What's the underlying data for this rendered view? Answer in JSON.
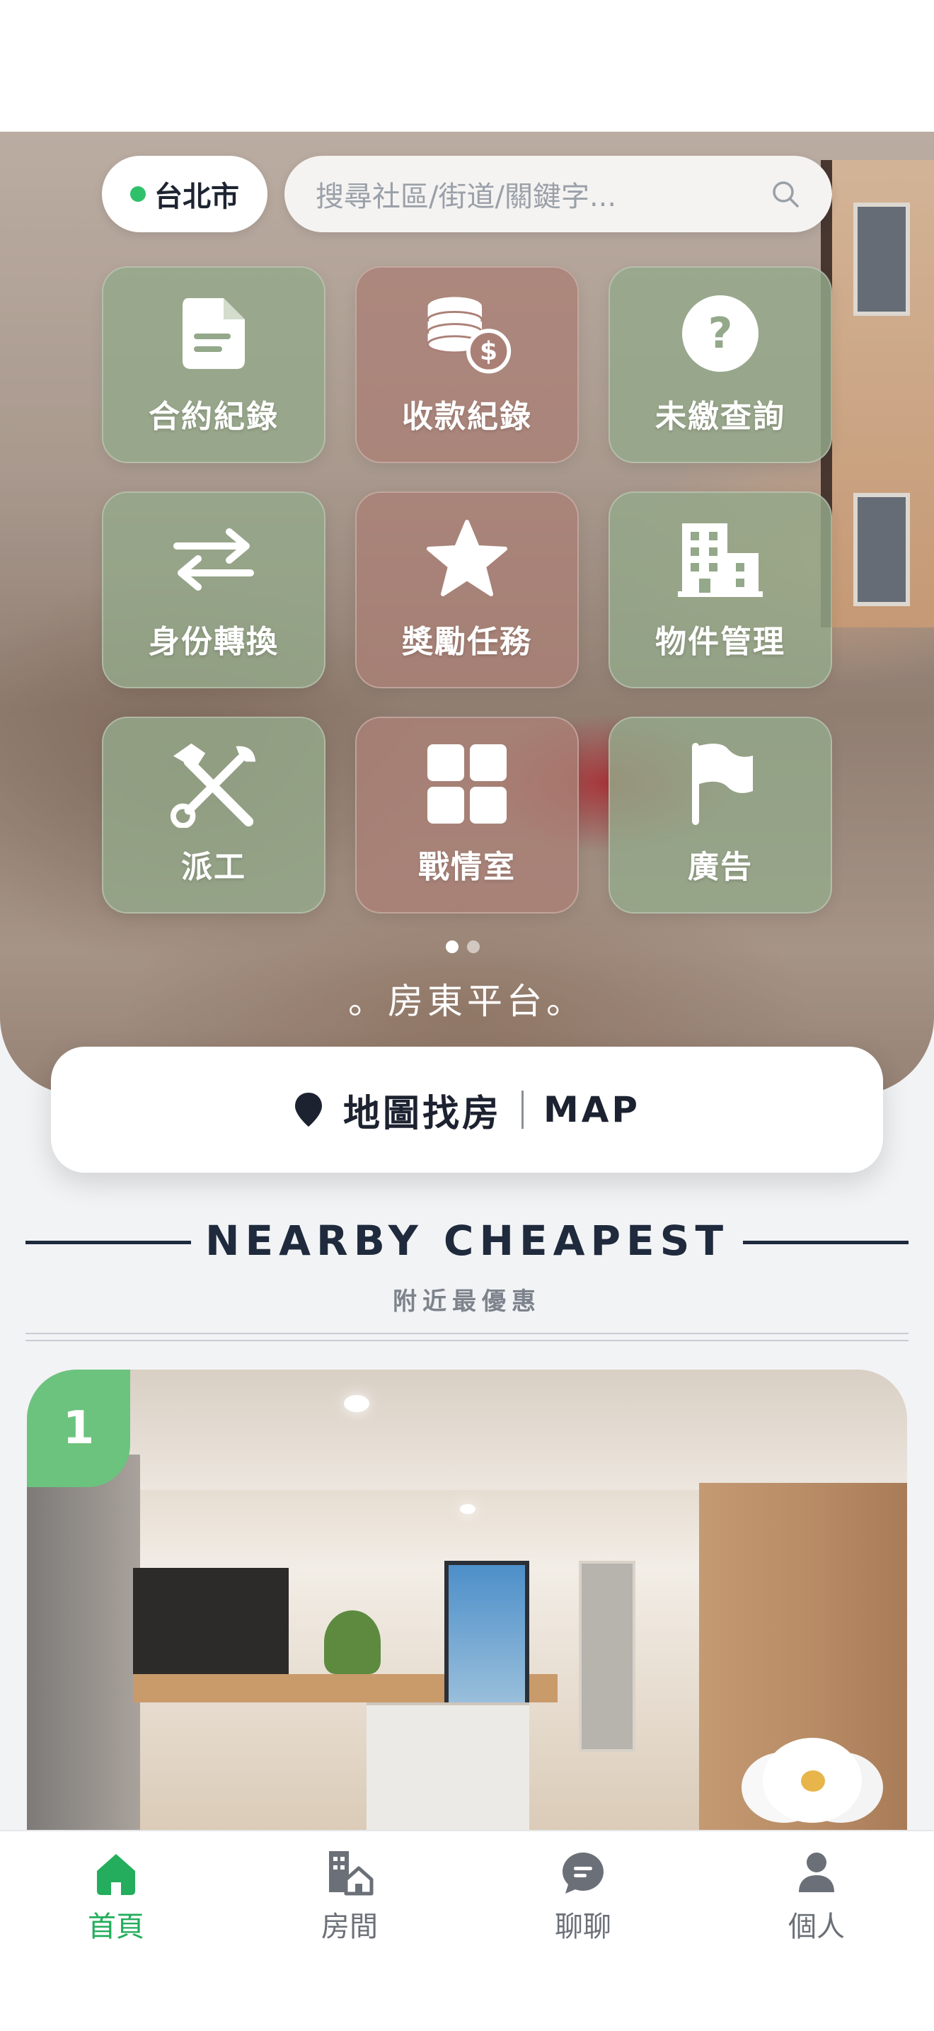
{
  "location": {
    "city": "台北市"
  },
  "search": {
    "placeholder": "搜尋社區/街道/關鍵字..."
  },
  "tiles": [
    {
      "label": "合約紀錄",
      "icon": "document-icon"
    },
    {
      "label": "收款紀錄",
      "icon": "coins-dollar-icon"
    },
    {
      "label": "未繳查詢",
      "icon": "question-circle-icon"
    },
    {
      "label": "身份轉換",
      "icon": "swap-arrows-icon"
    },
    {
      "label": "獎勵任務",
      "icon": "star-icon"
    },
    {
      "label": "物件管理",
      "icon": "building-icon"
    },
    {
      "label": "派工",
      "icon": "tools-icon"
    },
    {
      "label": "戰情室",
      "icon": "grid-icon"
    },
    {
      "label": "廣告",
      "icon": "flag-icon"
    }
  ],
  "pager": {
    "total": 2,
    "active": 1
  },
  "platform_label": "。房東平台。",
  "map_button": {
    "label": "地圖找房",
    "label_en": "MAP"
  },
  "section": {
    "title": "NEARBY CHEAPEST",
    "subtitle": "附近最優惠"
  },
  "listing": {
    "rank": "1"
  },
  "bottom_nav": [
    {
      "label": "首頁",
      "icon": "home-icon",
      "active": true
    },
    {
      "label": "房間",
      "icon": "rooms-icon",
      "active": false
    },
    {
      "label": "聊聊",
      "icon": "chat-icon",
      "active": false
    },
    {
      "label": "個人",
      "icon": "person-icon",
      "active": false
    }
  ],
  "colors": {
    "accent_green": "#23ad5c",
    "badge_green": "#6cc37e",
    "dark_text": "#1f2a3d"
  }
}
